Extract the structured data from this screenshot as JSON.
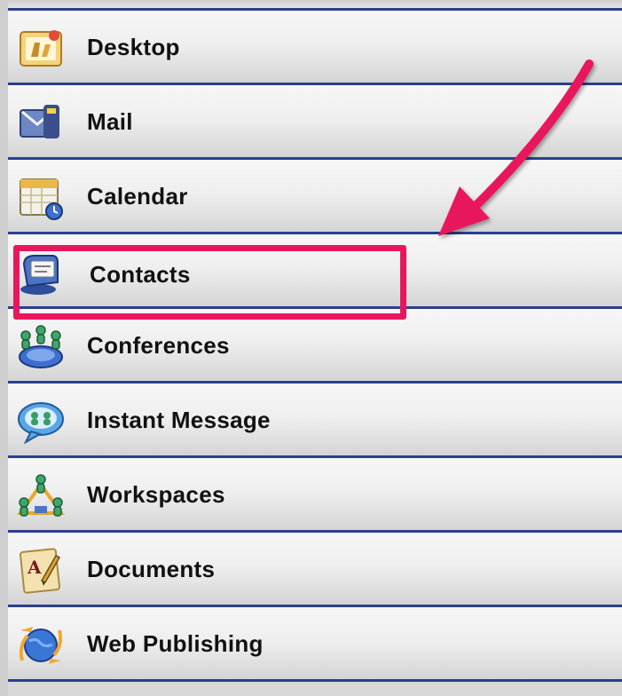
{
  "nav": {
    "items": [
      {
        "label": "Desktop",
        "icon": "desktop-icon"
      },
      {
        "label": "Mail",
        "icon": "mail-icon"
      },
      {
        "label": "Calendar",
        "icon": "calendar-icon"
      },
      {
        "label": "Contacts",
        "icon": "contacts-icon"
      },
      {
        "label": "Conferences",
        "icon": "conferences-icon"
      },
      {
        "label": "Instant Message",
        "icon": "instant-message-icon"
      },
      {
        "label": "Workspaces",
        "icon": "workspaces-icon"
      },
      {
        "label": "Documents",
        "icon": "documents-icon"
      },
      {
        "label": "Web Publishing",
        "icon": "web-publishing-icon"
      }
    ]
  },
  "annotation": {
    "highlighted_item": "Contacts",
    "color": "#e8175d"
  },
  "colors": {
    "divider": "#2a3f8f",
    "item_background": "#ececec",
    "text": "#111111"
  }
}
